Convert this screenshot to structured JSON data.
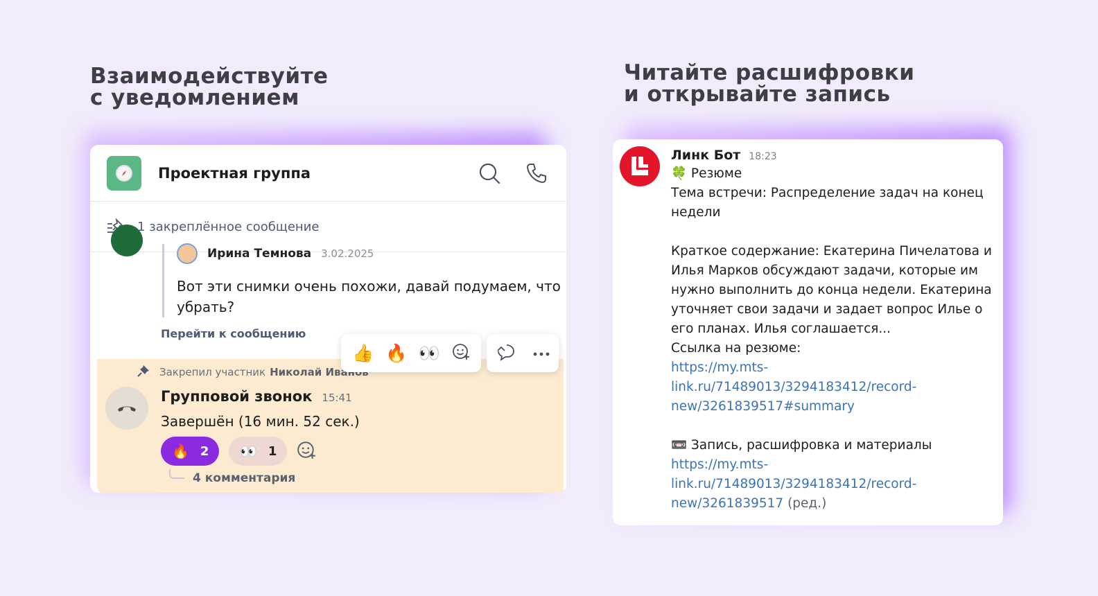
{
  "headlines": {
    "left": [
      "Взаимодействуйте",
      "с уведомлением"
    ],
    "right": [
      "Читайте расшифровки",
      "и открывайте запись"
    ]
  },
  "chat": {
    "title": "Проектная группа",
    "pinned_bar": "1 закреплённое сообщение",
    "quoted": {
      "author": "Ирина Темнова",
      "date": "3.02.2025",
      "text": "Вот эти снимки очень похожи, давай подумаем, что убрать?"
    },
    "goto_label": "Перейти к сообщению",
    "reaction_picker": [
      "👍",
      "🔥",
      "👀"
    ],
    "pinned_by_prefix": "Закрепил участник",
    "pinned_by_name": "Николай Иванов",
    "call": {
      "title": "Групповой звонок",
      "time": "15:41",
      "status": "Завершён (16 мин. 52 сек.)"
    },
    "reactions": [
      {
        "emoji": "🔥",
        "count": "2"
      },
      {
        "emoji": "👀",
        "count": "1"
      }
    ],
    "comments_label": "4 комментария"
  },
  "bot": {
    "name": "Линк Бот",
    "time": "18:23",
    "summary_title": "🍀 Резюме",
    "topic": "Тема встречи: Распределение задач на конец недели",
    "summary": "Краткое содержание: Екатерина Пичелатова и Илья Марков обсуждают задачи, которые им нужно выполнить до конца недели. Екатерина уточняет свои задачи и задает вопрос Илье о его планах. Илья соглашается...",
    "summary_link_label": "Ссылка на резюме:",
    "summary_link": "https://my.mts-link.ru/71489013/3294183412/record-new/3261839517#summary",
    "record_title": "📼 Запись, расшифровка и материалы",
    "record_link": "https://my.mts-link.ru/71489013/3294183412/record-new/3261839517",
    "edited": "(ред.)"
  },
  "colors": {
    "background": "#f1ebfb",
    "accent_purple": "#8a2be2",
    "call_block": "#fcebd0",
    "link": "#3a73b8",
    "bot_red": "#e3152a"
  }
}
